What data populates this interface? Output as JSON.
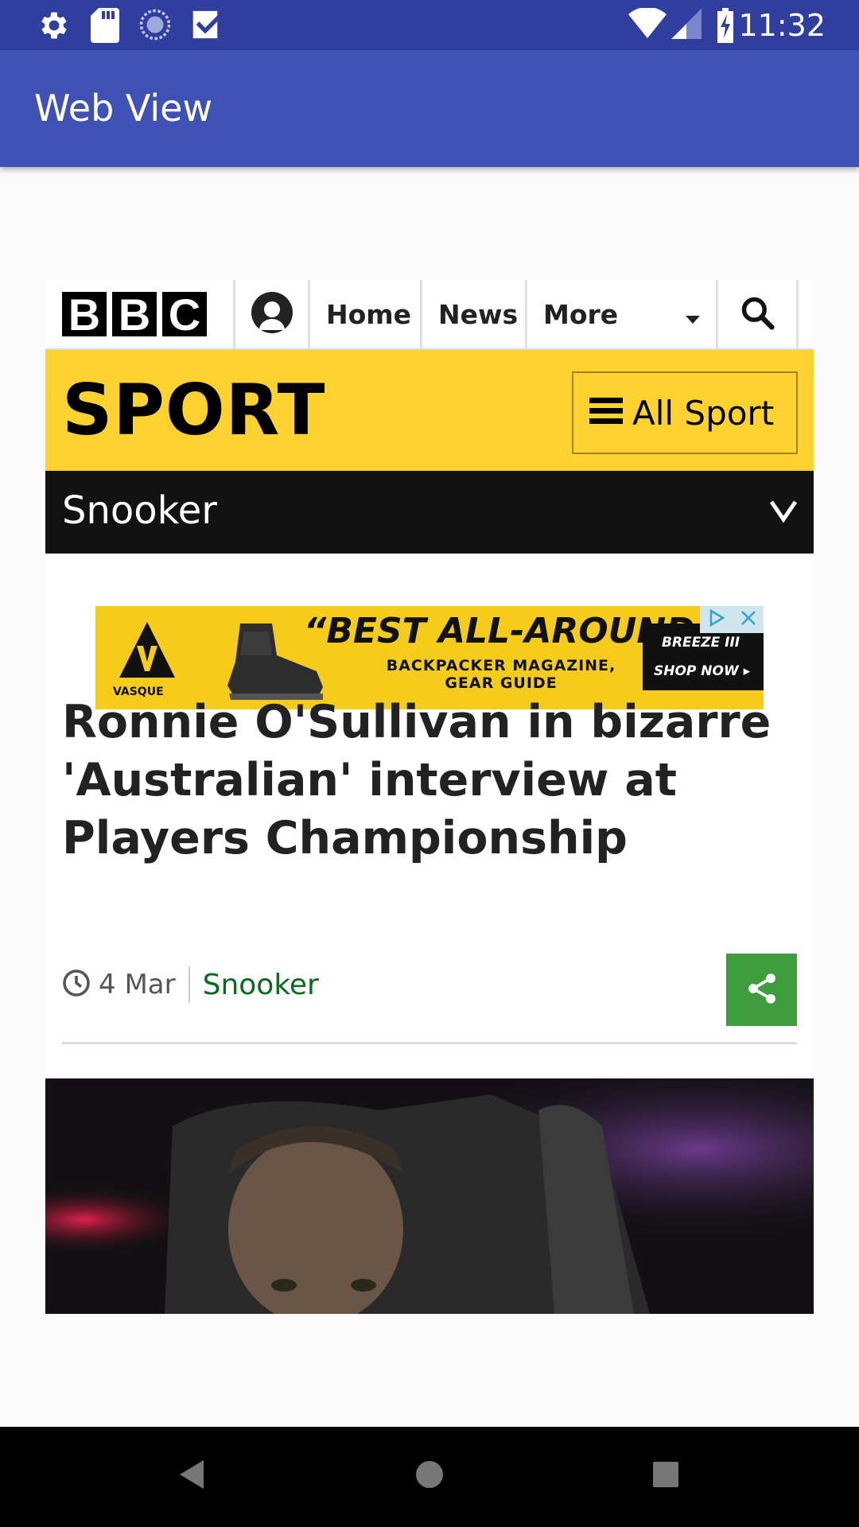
{
  "status_bar": {
    "time": "11:32",
    "left_icons": [
      "settings-icon",
      "sd-card-icon",
      "sync-icon",
      "task-icon"
    ],
    "right_icons": [
      "wifi-icon",
      "signal-icon",
      "battery-charging-icon"
    ]
  },
  "app_bar": {
    "title": "Web View"
  },
  "bbc_nav": {
    "logo_letters": [
      "B",
      "B",
      "C"
    ],
    "items": [
      {
        "label": "Home"
      },
      {
        "label": "News"
      },
      {
        "label": "More"
      }
    ]
  },
  "sport_header": {
    "title": "SPORT",
    "all_sport_label": "All Sport"
  },
  "section_bar": {
    "label": "Snooker"
  },
  "ad": {
    "headline": "“BEST ALL-AROUND”",
    "sub_line1": "BACKPACKER MAGAZINE,",
    "sub_line2": "GEAR GUIDE",
    "brand": "VASQUE",
    "cta_top": "BREEZE III",
    "cta_bottom": "SHOP NOW ▸"
  },
  "article": {
    "headline": "Ronnie O'Sullivan in bizarre 'Australian' interview at Players Championship",
    "date": "4 Mar",
    "section": "Snooker"
  },
  "colors": {
    "status_bar": "#303f9f",
    "app_bar": "#3f51b5",
    "sport_yellow": "#ffd230",
    "share_green": "#3e9e3e",
    "section_link_green": "#0b6a1c"
  }
}
